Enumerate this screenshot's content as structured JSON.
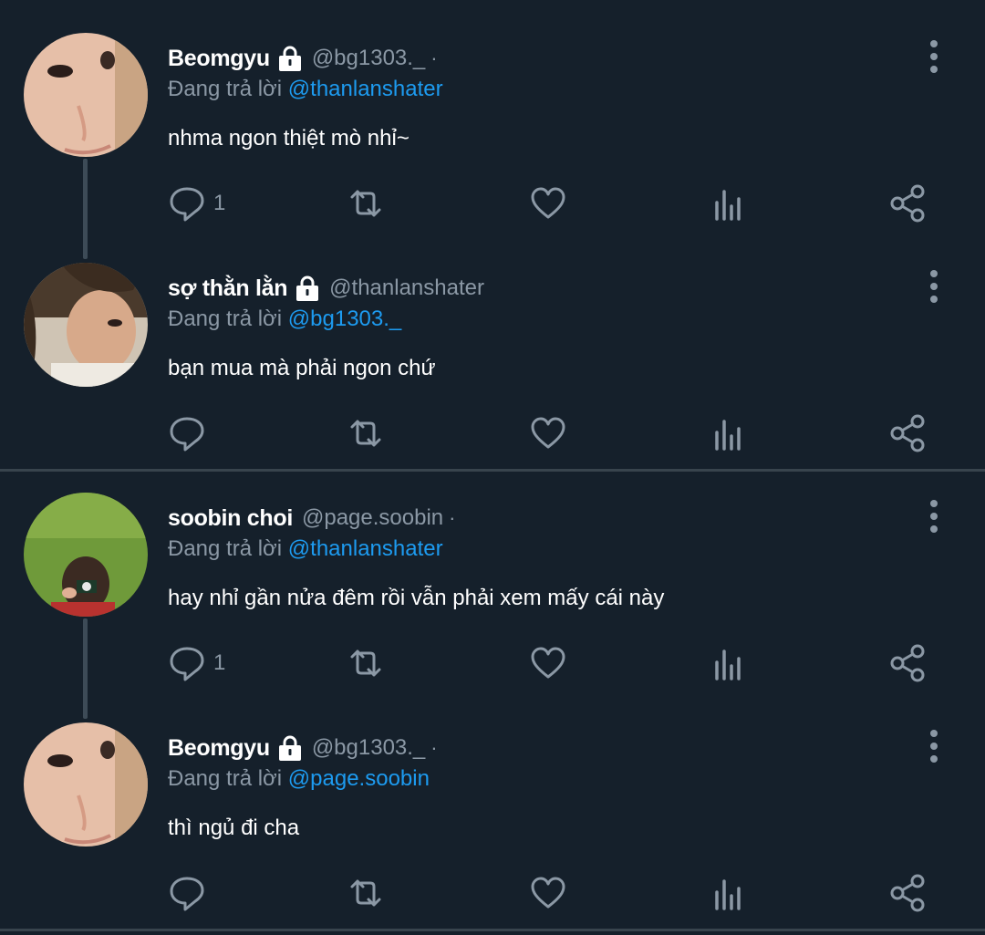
{
  "colors": {
    "background": "#15202b",
    "mention": "#1d9bf0",
    "secondary": "#8b98a5",
    "divider": "#38444d"
  },
  "labels": {
    "replying_prefix": "Đang trả lời"
  },
  "tweets": [
    {
      "name": "Beomgyu",
      "locked": true,
      "handle": "@bg1303._",
      "dot": "·",
      "replying_to": "@thanlanshater",
      "text": "nhma ngon thiệt mò nhỉ~",
      "reply_count": "1",
      "avatar_icon": "avatar-photo"
    },
    {
      "name": "sợ thằn lằn",
      "locked": true,
      "handle": "@thanlanshater",
      "dot": "",
      "replying_to": "@bg1303._",
      "text": "bạn mua mà phải ngon chứ",
      "reply_count": "",
      "avatar_icon": "avatar-photo"
    },
    {
      "name": "soobin choi",
      "locked": false,
      "handle": "@page.soobin",
      "dot": "·",
      "replying_to": "@thanlanshater",
      "text": "hay nhỉ gần nửa đêm rồi vẫn phải xem mấy cái này",
      "reply_count": "1",
      "avatar_icon": "avatar-photo"
    },
    {
      "name": "Beomgyu",
      "locked": true,
      "handle": "@bg1303._",
      "dot": "·",
      "replying_to": "@page.soobin",
      "text": "thì ngủ đi cha",
      "reply_count": "",
      "avatar_icon": "avatar-photo"
    }
  ]
}
